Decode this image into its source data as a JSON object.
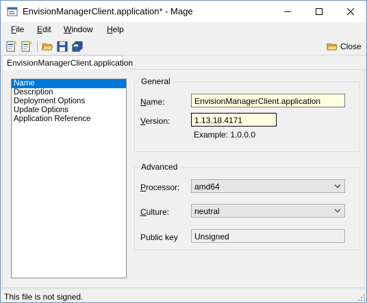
{
  "window": {
    "title": "EnvisionManagerClient.application* - Mage",
    "controls": {
      "minimize": "minimize-icon",
      "maximize": "maximize-icon",
      "close": "close-icon"
    }
  },
  "menu": {
    "items": [
      {
        "label": "File",
        "accel": "F",
        "rest": "ile"
      },
      {
        "label": "Edit",
        "accel": "E",
        "rest": "dit"
      },
      {
        "label": "Window",
        "accel": "W",
        "rest": "indow"
      },
      {
        "label": "Help",
        "accel": "H",
        "rest": "elp"
      }
    ]
  },
  "toolbar": {
    "icons": [
      "new-application-icon",
      "new-deployment-icon",
      "open-folder-icon",
      "save-icon",
      "save-all-icon"
    ],
    "close_label": "Close"
  },
  "tab": {
    "label": "EnvisionManagerClient.application"
  },
  "nav": {
    "items": [
      "Name",
      "Description",
      "Deployment Options",
      "Update Options",
      "Application Reference"
    ],
    "selected_index": 0
  },
  "general": {
    "legend": "General",
    "name_label_accel": "N",
    "name_label_rest": "ame:",
    "name_value": "EnvisionManagerClient.application",
    "version_label_accel": "V",
    "version_label_rest": "ersion:",
    "version_value": "1.13.18.4171",
    "example_text": "Example: 1.0.0.0"
  },
  "advanced": {
    "legend": "Advanced",
    "processor_label_accel": "P",
    "processor_label_rest": "rocessor:",
    "processor_value": "amd64",
    "culture_label_accel": "C",
    "culture_label_rest": "ulture:",
    "culture_value": "neutral",
    "public_key_label": "Public key",
    "public_key_value": "Unsigned"
  },
  "status": {
    "text": "This file is not signed."
  },
  "colors": {
    "selection": "#0078d7",
    "field_bg": "#ffffe1"
  }
}
